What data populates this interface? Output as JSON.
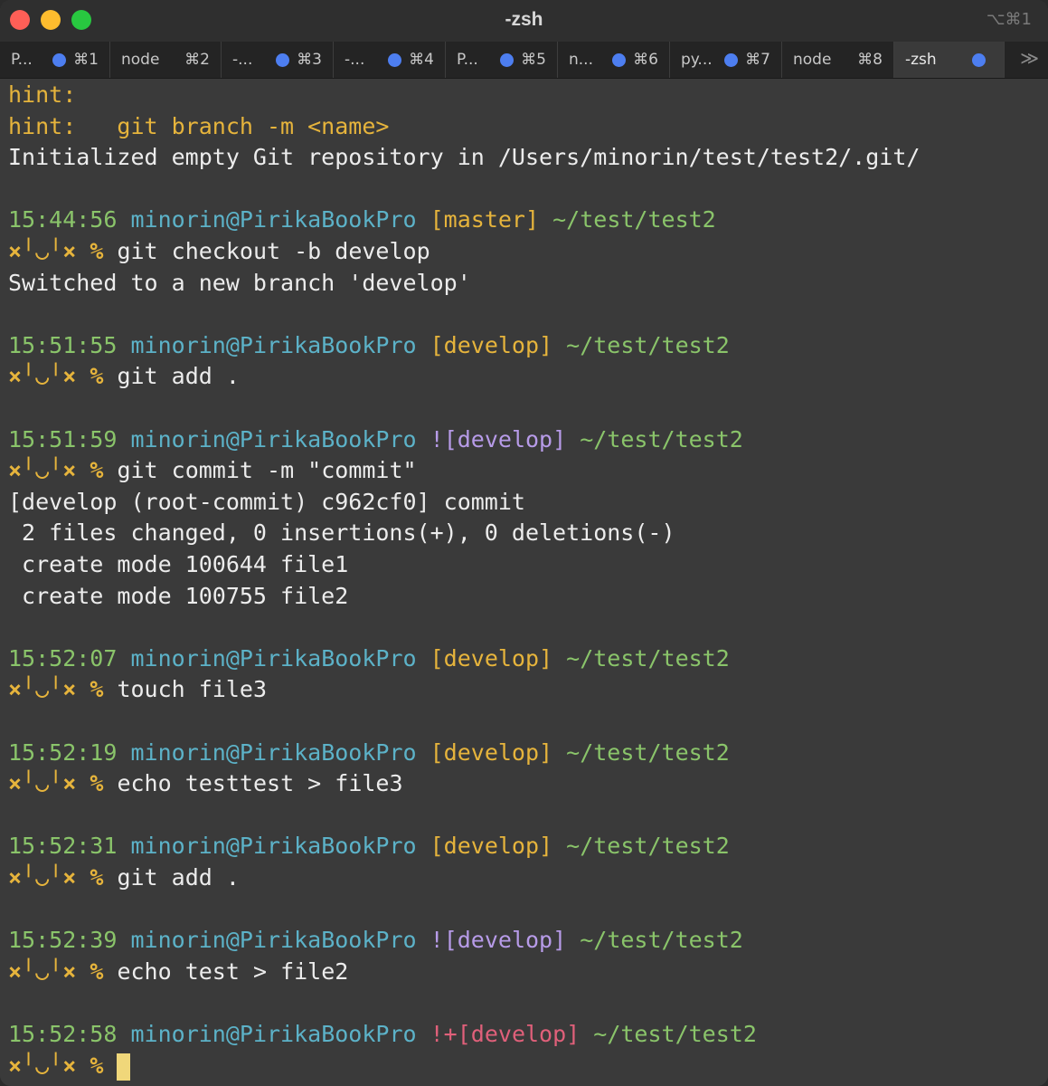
{
  "window": {
    "title": "-zsh",
    "shortcut": "⌥⌘1"
  },
  "tabs": [
    {
      "label": "P...",
      "shortcut": "⌘1",
      "dot": true
    },
    {
      "label": "node",
      "shortcut": "⌘2",
      "dot": false
    },
    {
      "label": "-...",
      "shortcut": "⌘3",
      "dot": true
    },
    {
      "label": "-...",
      "shortcut": "⌘4",
      "dot": true
    },
    {
      "label": "P...",
      "shortcut": "⌘5",
      "dot": true
    },
    {
      "label": "n...",
      "shortcut": "⌘6",
      "dot": true
    },
    {
      "label": "py...",
      "shortcut": "⌘7",
      "dot": true
    },
    {
      "label": "node",
      "shortcut": "⌘8",
      "dot": false
    },
    {
      "label": "-zsh",
      "shortcut": "",
      "dot": true
    }
  ],
  "tab_overflow": "≫",
  "terminal": {
    "output_top": [
      "hint:",
      "hint:   git branch -m <name>",
      "Initialized empty Git repository in /Users/minorin/test/test2/.git/"
    ],
    "prompt_face": "×╵◡╵×",
    "prompt_sigil": "%",
    "blocks": [
      {
        "time": "15:44:56",
        "user": "minorin@PirikaBookPro",
        "status": "",
        "branch": "[master]",
        "path": "~/test/test2",
        "command": "git checkout -b develop",
        "output": [
          "Switched to a new branch 'develop'"
        ]
      },
      {
        "time": "15:51:55",
        "user": "minorin@PirikaBookPro",
        "status": "",
        "branch": "[develop]",
        "path": "~/test/test2",
        "command": "git add .",
        "output": []
      },
      {
        "time": "15:51:59",
        "user": "minorin@PirikaBookPro",
        "status": "!",
        "branch": "[develop]",
        "path": "~/test/test2",
        "command": "git commit -m \"commit\"",
        "output": [
          "[develop (root-commit) c962cf0] commit",
          " 2 files changed, 0 insertions(+), 0 deletions(-)",
          " create mode 100644 file1",
          " create mode 100755 file2"
        ]
      },
      {
        "time": "15:52:07",
        "user": "minorin@PirikaBookPro",
        "status": "",
        "branch": "[develop]",
        "path": "~/test/test2",
        "command": "touch file3",
        "output": []
      },
      {
        "time": "15:52:19",
        "user": "minorin@PirikaBookPro",
        "status": "",
        "branch": "[develop]",
        "path": "~/test/test2",
        "command": "echo testtest > file3",
        "output": []
      },
      {
        "time": "15:52:31",
        "user": "minorin@PirikaBookPro",
        "status": "",
        "branch": "[develop]",
        "path": "~/test/test2",
        "command": "git add .",
        "output": []
      },
      {
        "time": "15:52:39",
        "user": "minorin@PirikaBookPro",
        "status": "!",
        "branch": "[develop]",
        "path": "~/test/test2",
        "command": "echo test > file2",
        "output": []
      },
      {
        "time": "15:52:58",
        "user": "minorin@PirikaBookPro",
        "status": "!+",
        "branch": "[develop]",
        "path": "~/test/test2",
        "command": "",
        "output": [],
        "cursor": true
      }
    ]
  },
  "colors": {
    "hint": "#e6b43c",
    "time": "#8ac46a",
    "user": "#5cb2c8",
    "branch_clean": "#e6b43c",
    "branch_dirty": "#b79be8",
    "branch_staged": "#e0607a",
    "path": "#8ac46a",
    "cursor": "#f0d77a",
    "tab_dot": "#4d7ef0"
  }
}
